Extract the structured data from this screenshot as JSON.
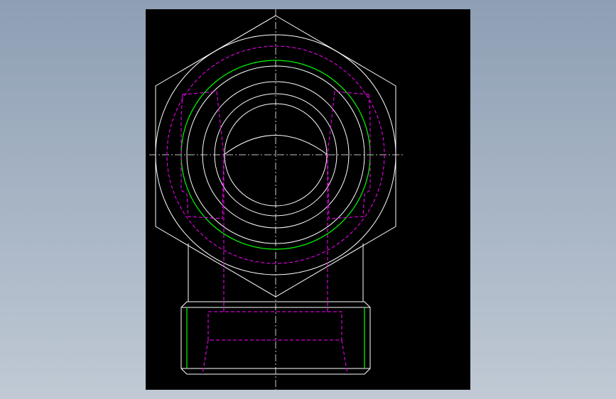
{
  "viewport": {
    "background": "#000000",
    "layer_colors": {
      "visible_edges": "#ffffff",
      "hidden_edges": "#ff00ff",
      "thread_lines": "#00ff00",
      "center_lines": "#ffffff"
    }
  },
  "drawing": {
    "views": [
      "top-view-hex-fitting",
      "front-view-threaded-body"
    ],
    "line_types": [
      "continuous",
      "dashed-hidden",
      "dash-dot-center"
    ]
  }
}
